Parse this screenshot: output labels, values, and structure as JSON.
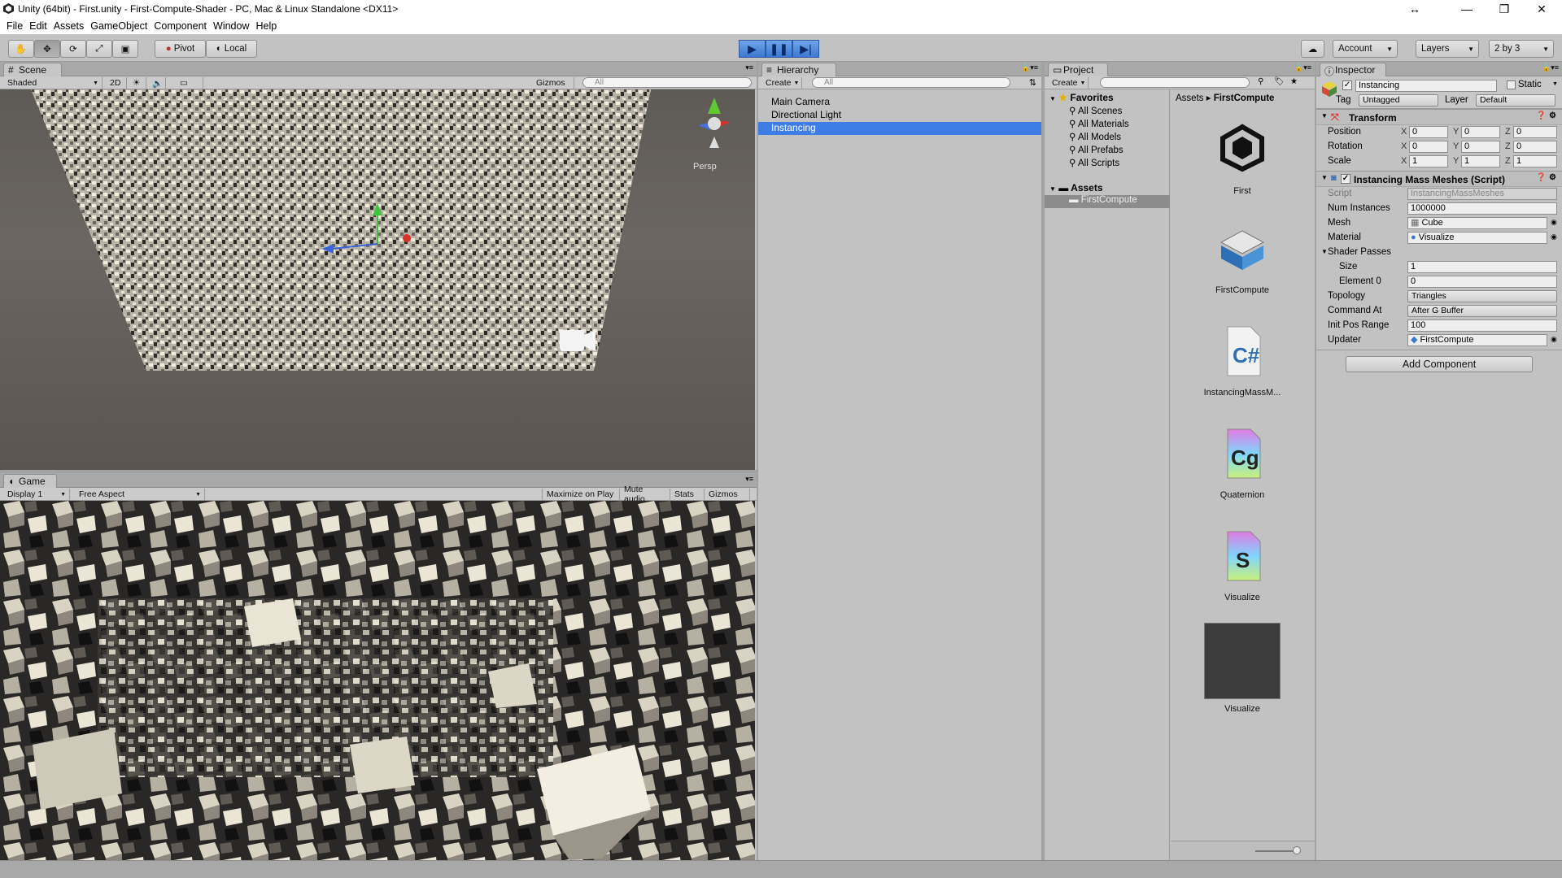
{
  "window": {
    "title": "Unity (64bit) - First.unity - First-Compute-Shader - PC, Mac & Linux Standalone <DX11>"
  },
  "menu": [
    "File",
    "Edit",
    "Assets",
    "GameObject",
    "Component",
    "Window",
    "Help"
  ],
  "toolbar": {
    "pivot": "Pivot",
    "local": "Local",
    "account": "Account",
    "layers": "Layers",
    "layout": "2 by 3"
  },
  "scene": {
    "tab": "Scene",
    "shading": "Shaded",
    "mode2d": "2D",
    "gizmos": "Gizmos",
    "search": "All",
    "persp": "Persp"
  },
  "game": {
    "tab": "Game",
    "display": "Display 1",
    "aspect": "Free Aspect",
    "maximize": "Maximize on Play",
    "mute": "Mute audio",
    "stats": "Stats",
    "gizmos": "Gizmos"
  },
  "hierarchy": {
    "tab": "Hierarchy",
    "create": "Create",
    "search": "All",
    "items": [
      "Main Camera",
      "Directional Light",
      "Instancing"
    ],
    "selected_index": 2
  },
  "project": {
    "tab": "Project",
    "create": "Create",
    "favorites_label": "Favorites",
    "favorites": [
      "All Scenes",
      "All Materials",
      "All Models",
      "All Prefabs",
      "All Scripts"
    ],
    "assets_label": "Assets",
    "folders": [
      "FirstCompute"
    ],
    "breadcrumb": [
      "Assets",
      "FirstCompute"
    ],
    "assets": [
      {
        "name": "First",
        "icon": "unity-scene-icon"
      },
      {
        "name": "FirstCompute",
        "icon": "compute-shader-icon"
      },
      {
        "name": "InstancingMassM...",
        "icon": "csharp-script-icon"
      },
      {
        "name": "Quaternion",
        "icon": "cg-include-icon"
      },
      {
        "name": "Visualize",
        "icon": "shader-icon"
      },
      {
        "name": "Visualize",
        "icon": "material-icon"
      }
    ]
  },
  "inspector": {
    "tab": "Inspector",
    "object_name": "Instancing",
    "static_label": "Static",
    "tag_label": "Tag",
    "tag": "Untagged",
    "layer_label": "Layer",
    "layer": "Default",
    "transform": {
      "title": "Transform",
      "position_label": "Position",
      "position": [
        "0",
        "0",
        "0"
      ],
      "rotation_label": "Rotation",
      "rotation": [
        "0",
        "0",
        "0"
      ],
      "scale_label": "Scale",
      "scale": [
        "1",
        "1",
        "1"
      ]
    },
    "script_component": {
      "title": "Instancing Mass Meshes (Script)",
      "script_label": "Script",
      "script": "InstancingMassMeshes",
      "num_instances_label": "Num Instances",
      "num_instances": "1000000",
      "mesh_label": "Mesh",
      "mesh": "Cube",
      "material_label": "Material",
      "material": "Visualize",
      "shader_passes_label": "Shader Passes",
      "size_label": "Size",
      "size": "1",
      "element0_label": "Element 0",
      "element0": "0",
      "topology_label": "Topology",
      "topology": "Triangles",
      "command_at_label": "Command At",
      "command_at": "After G Buffer",
      "init_pos_label": "Init Pos Range",
      "init_pos": "100",
      "updater_label": "Updater",
      "updater": "FirstCompute"
    },
    "add_component": "Add Component"
  }
}
